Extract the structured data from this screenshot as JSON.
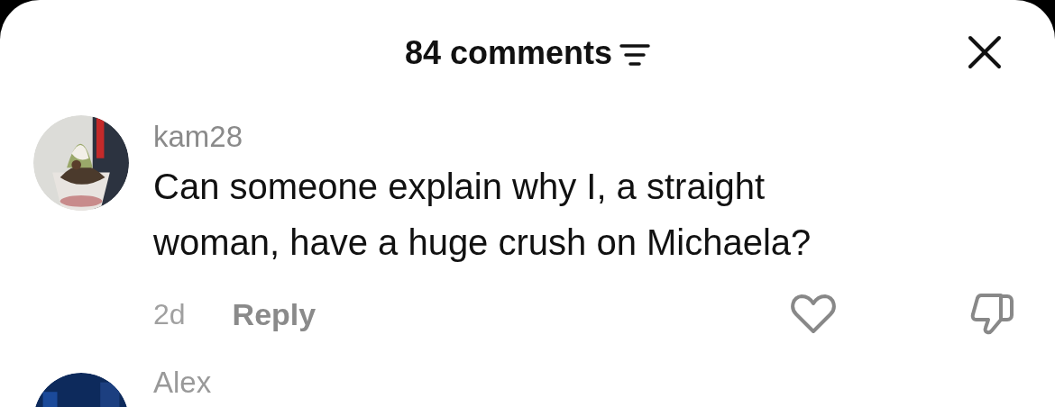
{
  "header": {
    "title": "84 comments"
  },
  "comments": [
    {
      "username": "kam28",
      "text": "Can someone explain why I, a straight woman, have a huge crush on Michaela?",
      "time": "2d",
      "reply": "Reply",
      "liked": false,
      "disliked": false
    },
    {
      "username": "Alex"
    }
  ]
}
